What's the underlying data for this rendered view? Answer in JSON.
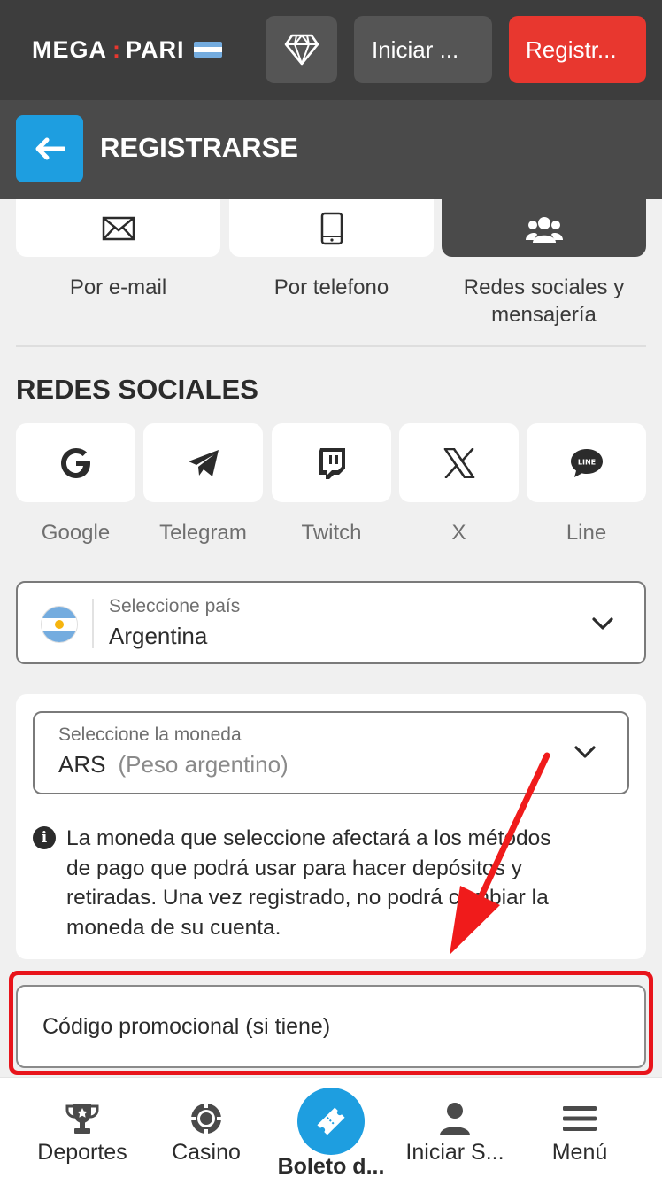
{
  "header": {
    "logo_left": "MEGA",
    "logo_sep": ":",
    "logo_right": "PARI",
    "login_label": "Iniciar ...",
    "register_label": "Registr..."
  },
  "subheader": {
    "title": "REGISTRARSE"
  },
  "methods": [
    {
      "label": "Por e-mail",
      "icon": "envelope-icon"
    },
    {
      "label": "Por telefono",
      "icon": "phone-icon"
    },
    {
      "label": "Redes sociales y mensajería",
      "icon": "users-icon",
      "active": true
    }
  ],
  "social": {
    "title": "REDES SOCIALES",
    "items": [
      {
        "label": "Google",
        "icon": "google-icon"
      },
      {
        "label": "Telegram",
        "icon": "telegram-icon"
      },
      {
        "label": "Twitch",
        "icon": "twitch-icon"
      },
      {
        "label": "X",
        "icon": "x-icon"
      },
      {
        "label": "Line",
        "icon": "line-icon"
      }
    ]
  },
  "country": {
    "label": "Seleccione país",
    "value": "Argentina"
  },
  "currency": {
    "label": "Seleccione la moneda",
    "code": "ARS",
    "name": "(Peso argentino)",
    "info": "La moneda que seleccione afectará a los métodos de pago que podrá usar para hacer depósitos y retiradas. Una vez registrado, no podrá cambiar la moneda de su cuenta."
  },
  "promo": {
    "placeholder": "Código promocional (si tiene)"
  },
  "nav": [
    {
      "label": "Deportes",
      "icon": "trophy-icon"
    },
    {
      "label": "Casino",
      "icon": "casino-chip-icon"
    },
    {
      "label": "Boleto d...",
      "icon": "ticket-icon"
    },
    {
      "label": "Iniciar S...",
      "icon": "user-icon"
    },
    {
      "label": "Menú",
      "icon": "menu-icon"
    }
  ],
  "colors": {
    "accent": "#1e9ee0",
    "brand_red": "#e8372f",
    "highlight": "#e8141b"
  }
}
